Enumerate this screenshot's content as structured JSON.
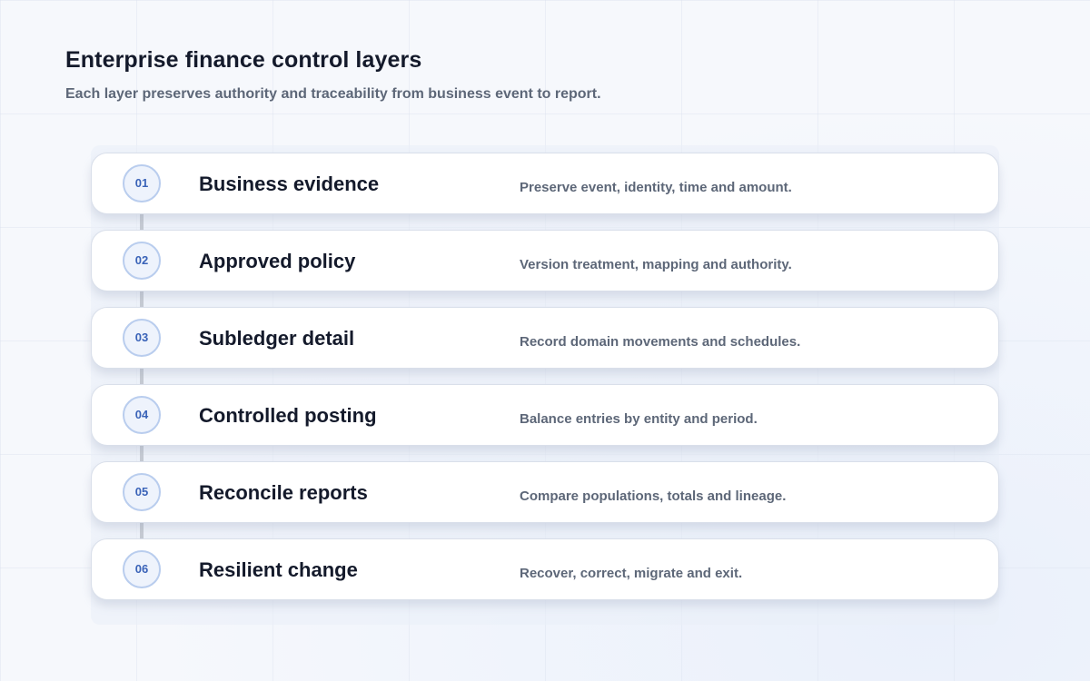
{
  "header": {
    "title": "Enterprise finance control layers",
    "subtitle": "Each layer preserves authority and traceability from business event to report."
  },
  "layers": [
    {
      "number": "01",
      "title": "Business evidence",
      "description": "Preserve event, identity, time and amount."
    },
    {
      "number": "02",
      "title": "Approved policy",
      "description": "Version treatment, mapping and authority."
    },
    {
      "number": "03",
      "title": "Subledger detail",
      "description": "Record domain movements and schedules."
    },
    {
      "number": "04",
      "title": "Controlled posting",
      "description": "Balance entries by entity and period."
    },
    {
      "number": "05",
      "title": "Reconcile reports",
      "description": "Compare populations, totals and lineage."
    },
    {
      "number": "06",
      "title": "Resilient change",
      "description": "Recover, correct, migrate and exit."
    }
  ],
  "colors": {
    "badge_accent": "#3a63b8",
    "badge_border": "#b9cdee",
    "title_text": "#141a2b",
    "muted_text": "#5d6778",
    "connector": "#c6cbd3"
  }
}
